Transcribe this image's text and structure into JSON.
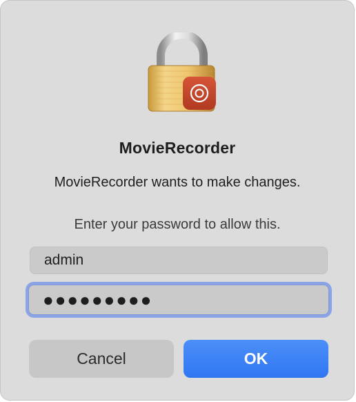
{
  "dialog": {
    "app_name": "MovieRecorder",
    "message": "MovieRecorder wants to make changes.",
    "prompt": "Enter your password to allow this.",
    "icon": "lock-icon",
    "badge_icon": "record-icon"
  },
  "fields": {
    "username_value": "admin",
    "password_value": "●●●●●●●●●"
  },
  "buttons": {
    "cancel_label": "Cancel",
    "ok_label": "OK"
  },
  "colors": {
    "accent": "#3a82f7",
    "badge": "#c6432a",
    "dialog_bg": "#dcdcdc"
  }
}
